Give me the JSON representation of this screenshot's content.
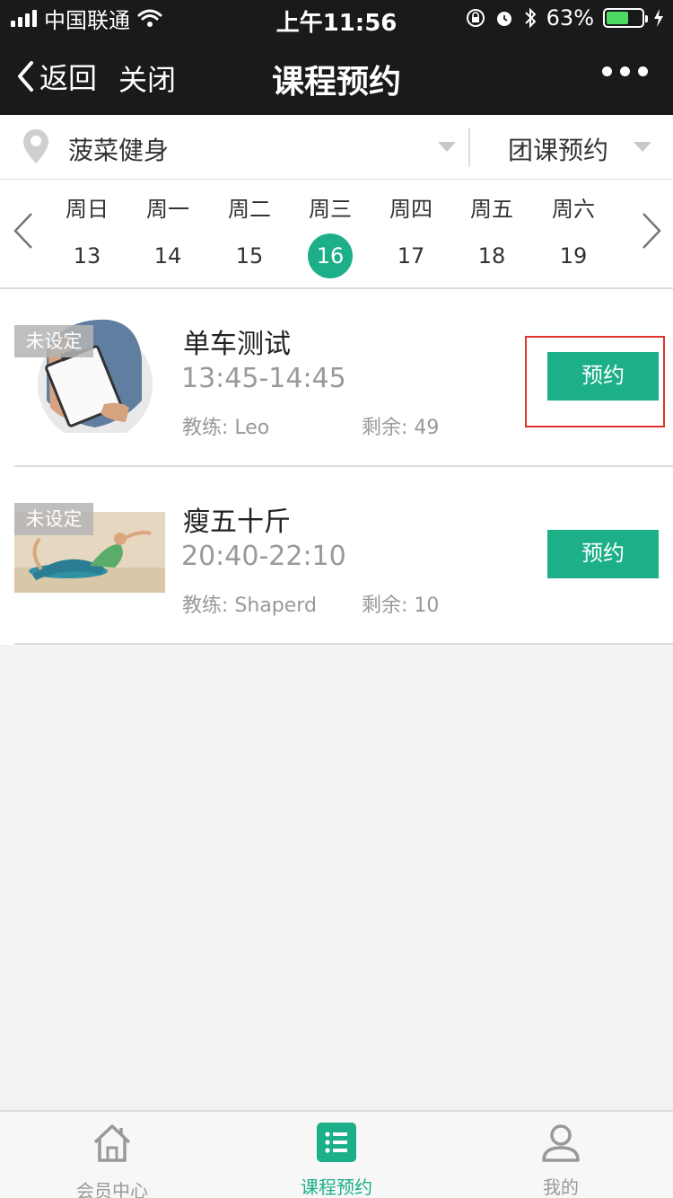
{
  "status_bar": {
    "carrier": "中国联通",
    "time": "上午11:56",
    "battery_pct": "63%",
    "battery_level": 0.63,
    "battery_color": "#4cd964"
  },
  "nav": {
    "back_label": "返回",
    "close_label": "关闭",
    "title": "课程预约"
  },
  "filter": {
    "store": "菠菜健身",
    "type": "团课预约"
  },
  "week": {
    "days": [
      {
        "weekday": "周日",
        "date": "13"
      },
      {
        "weekday": "周一",
        "date": "14"
      },
      {
        "weekday": "周二",
        "date": "15"
      },
      {
        "weekday": "周三",
        "date": "16"
      },
      {
        "weekday": "周四",
        "date": "17"
      },
      {
        "weekday": "周五",
        "date": "18"
      },
      {
        "weekday": "周六",
        "date": "19"
      }
    ],
    "selected_date": "16"
  },
  "courses": [
    {
      "tag": "未设定",
      "name": "单车测试",
      "time": "13:45-14:45",
      "coach": "教练: Leo",
      "remaining": "剩余: 49",
      "button": "预约"
    },
    {
      "tag": "未设定",
      "name": "瘦五十斤",
      "time": "20:40-22:10",
      "coach": "教练: Shaperd",
      "remaining": "剩余: 10",
      "button": "预约"
    }
  ],
  "tabs": [
    {
      "label": "会员中心",
      "icon": "home-icon"
    },
    {
      "label": "课程预约",
      "icon": "list-icon"
    },
    {
      "label": "我的",
      "icon": "user-icon"
    }
  ],
  "colors": {
    "accent": "#1db088",
    "nav_bg": "#1a1a1a",
    "highlight": "#e0342c"
  }
}
